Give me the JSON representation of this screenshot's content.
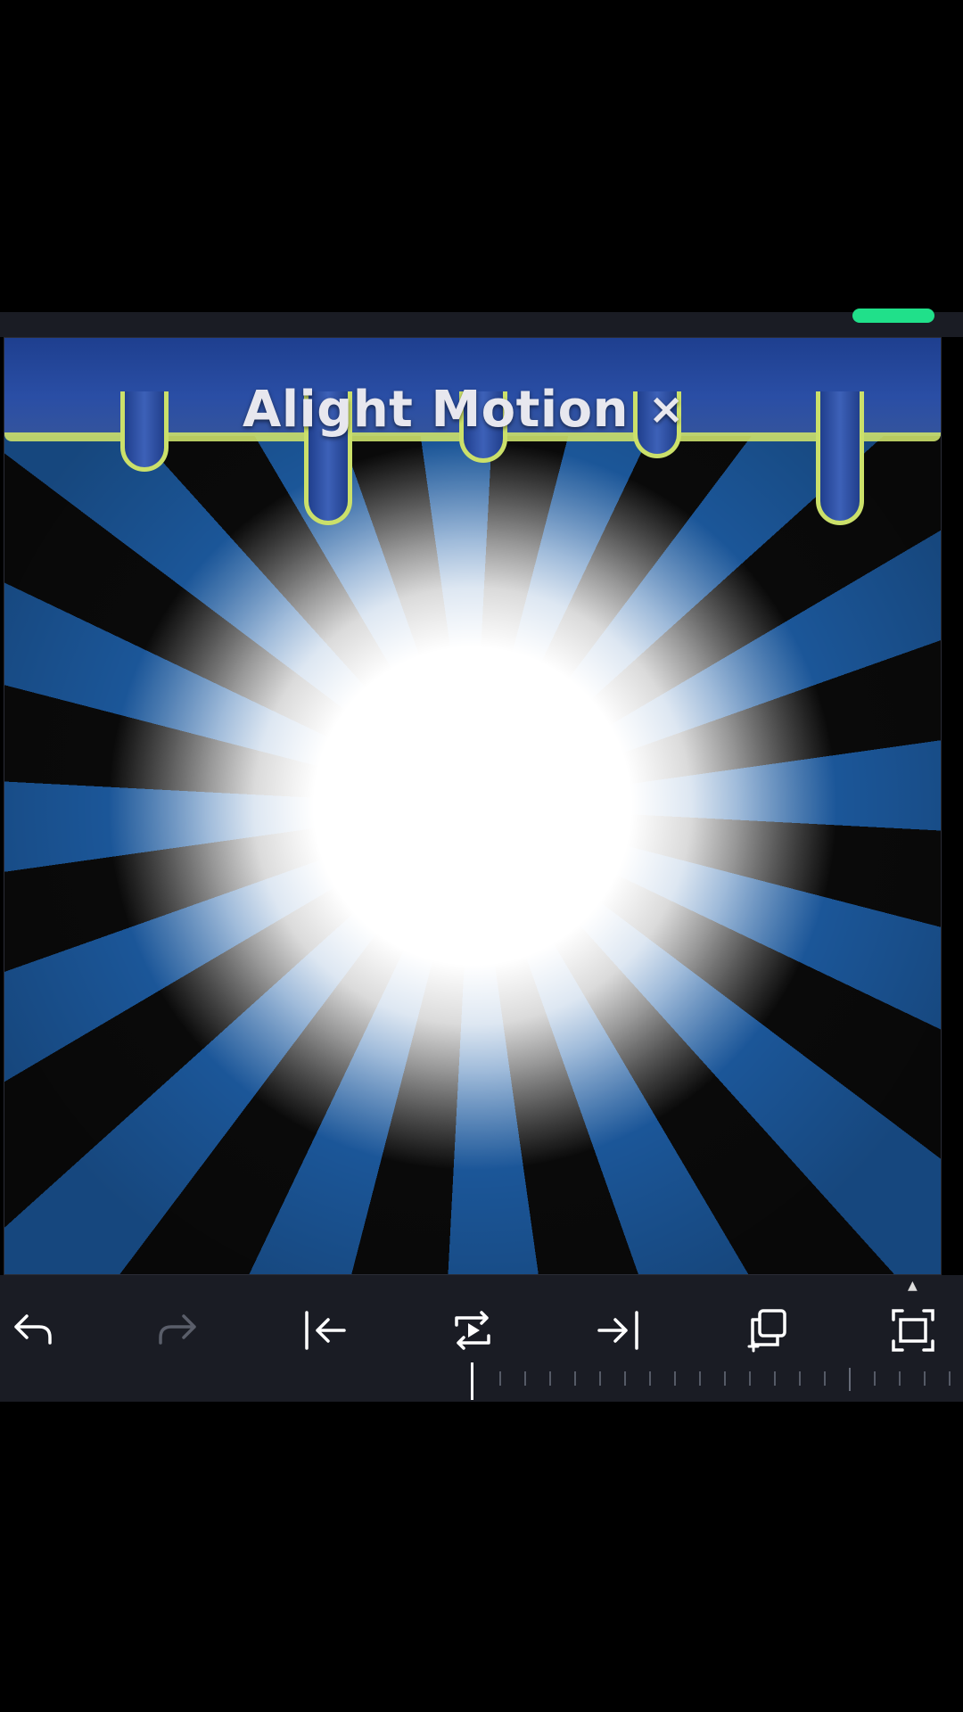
{
  "watermark": {
    "text": "Alight Motion",
    "close_symbol": "×"
  },
  "toolbar": {
    "icons": [
      "undo-icon",
      "redo-icon",
      "jump-to-start-icon",
      "loop-play-icon",
      "jump-to-end-icon",
      "duplicate-icon",
      "fullscreen-icon"
    ]
  },
  "colors": {
    "background": "#000000",
    "toolbar": "#1a1c24",
    "indicator": "#20e08a",
    "ray_blue": "#1e5fa8",
    "drip_blue": "#2a4ea5",
    "drip_outline": "#cbe06a"
  }
}
